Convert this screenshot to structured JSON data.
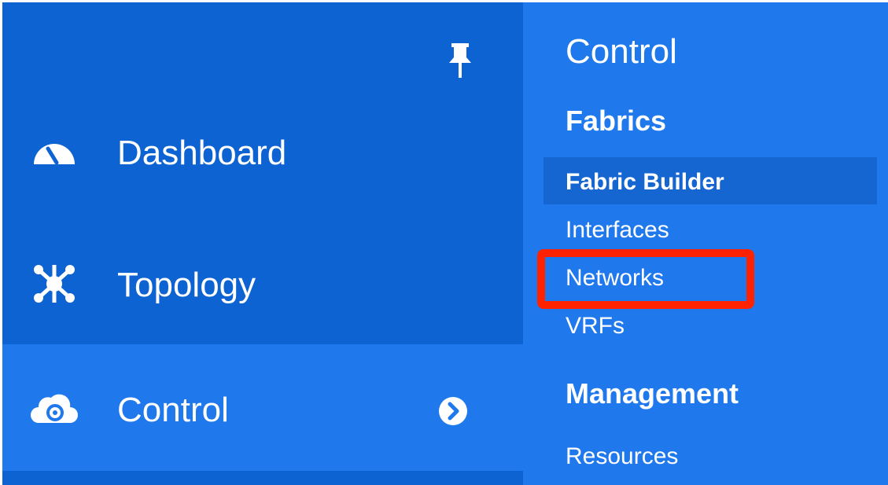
{
  "sidebar": {
    "pin_icon": "pin-icon",
    "items": [
      {
        "label": "Dashboard",
        "icon": "dashboard-gauge-icon"
      },
      {
        "label": "Topology",
        "icon": "topology-network-icon"
      },
      {
        "label": "Control",
        "icon": "control-cloud-icon",
        "active": true,
        "has_submenu": true
      }
    ]
  },
  "flyout": {
    "title": "Control",
    "sections": [
      {
        "heading": "Fabrics",
        "links": [
          {
            "label": "Fabric Builder",
            "selected": true
          },
          {
            "label": "Interfaces"
          },
          {
            "label": "Networks",
            "highlighted": true
          },
          {
            "label": "VRFs"
          }
        ]
      },
      {
        "heading": "Management",
        "links": [
          {
            "label": "Resources"
          }
        ]
      }
    ]
  },
  "colors": {
    "sidebar_bg": "#0d63d2",
    "active_bg": "#1f78ec",
    "flyout_bg": "#1f78ec",
    "selected_link_bg": "#1566d0",
    "highlight_border": "#ff2200",
    "text": "#ffffff"
  }
}
